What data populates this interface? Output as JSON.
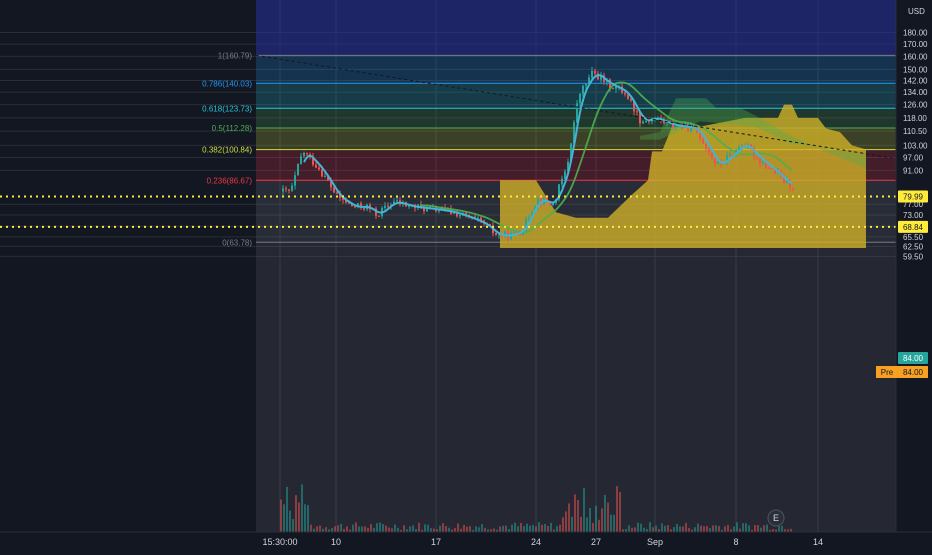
{
  "colors": {
    "background": "#131722",
    "grid": "#2a2e39",
    "candle_up": "#26a69a",
    "candle_down": "#ef5350",
    "ma_fast": "#42b4d6",
    "ma_slow": "#4caf50",
    "axis_text": "#d1d4dc",
    "dotted_level": "#ffeb3b",
    "last_price_badge": "#26a69a",
    "pre_badge": "#f7a021"
  },
  "price_axis": {
    "currency": "USD",
    "ticks": [
      "180.00",
      "170.00",
      "160.00",
      "150.00",
      "142.00",
      "134.00",
      "126.00",
      "118.00",
      "110.50",
      "103.00",
      "97.00",
      "91.00",
      "77.00",
      "73.00",
      "69.00",
      "65.50",
      "62.50",
      "59.50"
    ]
  },
  "time_axis": {
    "ticks": [
      "15:30:00",
      "10",
      "17",
      "24",
      "27",
      "Sep",
      "8",
      "14"
    ]
  },
  "price_badges": {
    "last": "84.00",
    "pre_label": "Pre",
    "pre_value": "84.00",
    "level_1": "79.99",
    "level_2": "68.84"
  },
  "earnings_marker": "E",
  "chart_data": {
    "type": "candlestick",
    "title": "",
    "scale": "log",
    "ylim": [
      58,
      180
    ],
    "fibonacci_levels": [
      {
        "ratio": 1,
        "label": "1(160.79)",
        "price": 160.79,
        "color": "#787b86"
      },
      {
        "ratio": 0.786,
        "label": "0.786(140.03)",
        "price": 140.03,
        "color": "#2196f3"
      },
      {
        "ratio": 0.618,
        "label": "0.618(123.73)",
        "price": 123.73,
        "color": "#26c6da"
      },
      {
        "ratio": 0.5,
        "label": "0.5(112.28)",
        "price": 112.28,
        "color": "#4caf50"
      },
      {
        "ratio": 0.382,
        "label": "0.382(100.84)",
        "price": 100.84,
        "color": "#cddc39"
      },
      {
        "ratio": 0.236,
        "label": "0.236(86.67)",
        "price": 86.67,
        "color": "#f23645"
      },
      {
        "ratio": 0,
        "label": "0(63.78)",
        "price": 63.78,
        "color": "#787b86"
      }
    ],
    "horizontal_levels": [
      79.99,
      68.84
    ],
    "last_price": 84.0,
    "close_path": [
      {
        "date": "Aug 8",
        "price": 82
      },
      {
        "date": "Aug 9",
        "price": 100
      },
      {
        "date": "Aug 10",
        "price": 92
      },
      {
        "date": "Aug 11",
        "price": 80
      },
      {
        "date": "Aug 12",
        "price": 76
      },
      {
        "date": "Aug 13",
        "price": 76
      },
      {
        "date": "Aug 14",
        "price": 73
      },
      {
        "date": "Aug 15",
        "price": 78
      },
      {
        "date": "Aug 16",
        "price": 76
      },
      {
        "date": "Aug 17",
        "price": 75
      },
      {
        "date": "Aug 18",
        "price": 74
      },
      {
        "date": "Aug 19",
        "price": 72
      },
      {
        "date": "Aug 20",
        "price": 70
      },
      {
        "date": "Aug 21",
        "price": 66
      },
      {
        "date": "Aug 22",
        "price": 66
      },
      {
        "date": "Aug 23",
        "price": 68
      },
      {
        "date": "Aug 24",
        "price": 79
      },
      {
        "date": "Aug 25",
        "price": 77
      },
      {
        "date": "Aug 26",
        "price": 92
      },
      {
        "date": "Aug 27",
        "price": 132
      },
      {
        "date": "Aug 28",
        "price": 148
      },
      {
        "date": "Aug 29",
        "price": 140
      },
      {
        "date": "Aug 30",
        "price": 134
      },
      {
        "date": "Sep 1",
        "price": 116
      },
      {
        "date": "Sep 2",
        "price": 118
      },
      {
        "date": "Sep 4",
        "price": 114
      },
      {
        "date": "Sep 5",
        "price": 112
      },
      {
        "date": "Sep 6",
        "price": 93
      },
      {
        "date": "Sep 7",
        "price": 98
      },
      {
        "date": "Sep 8",
        "price": 104
      },
      {
        "date": "Sep 9",
        "price": 96
      },
      {
        "date": "Sep 10",
        "price": 91
      },
      {
        "date": "Sep 11",
        "price": 86
      },
      {
        "date": "Sep 12",
        "price": 84
      }
    ]
  }
}
